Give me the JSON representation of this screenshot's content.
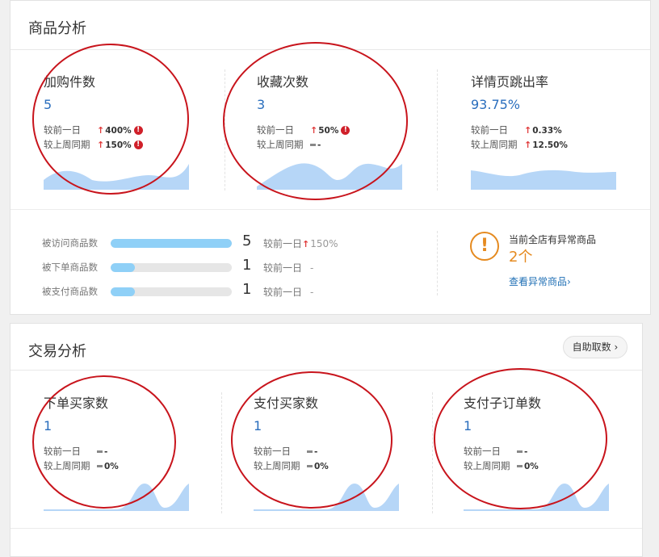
{
  "goods_analysis": {
    "title": "商品分析",
    "metrics": [
      {
        "title": "加购件数",
        "value": "5",
        "day_label": "较前一日",
        "day_value": "400%",
        "day_trend": "up",
        "day_alert": true,
        "week_label": "较上周同期",
        "week_value": "150%",
        "week_trend": "up",
        "week_alert": true
      },
      {
        "title": "收藏次数",
        "value": "3",
        "day_label": "较前一日",
        "day_value": "50%",
        "day_trend": "up",
        "day_alert": true,
        "week_label": "较上周同期",
        "week_value": "-",
        "week_trend": "flat",
        "week_alert": false
      },
      {
        "title": "详情页跳出率",
        "value": "93.75%",
        "day_label": "较前一日",
        "day_value": "0.33%",
        "day_trend": "up",
        "day_alert": false,
        "week_label": "较上周同期",
        "week_value": "12.50%",
        "week_trend": "up",
        "week_alert": false
      }
    ],
    "bars": [
      {
        "label": "被访问商品数",
        "count": "5",
        "cmp_label": "较前一日",
        "cmp_value": "150%",
        "trend": "up",
        "fill": 1.0
      },
      {
        "label": "被下单商品数",
        "count": "1",
        "cmp_label": "较前一日",
        "cmp_value": "-",
        "trend": "flat",
        "fill": 0.2
      },
      {
        "label": "被支付商品数",
        "count": "1",
        "cmp_label": "较前一日",
        "cmp_value": "-",
        "trend": "flat",
        "fill": 0.2
      }
    ],
    "warning": {
      "icon": "exclamation-circle-icon",
      "text": "当前全店有异常商品",
      "count": "2个",
      "link": "查看异常商品"
    }
  },
  "trade_analysis": {
    "title": "交易分析",
    "button": "自助取数",
    "metrics": [
      {
        "title": "下单买家数",
        "value": "1",
        "day_label": "较前一日",
        "day_value": "-",
        "day_trend": "flat",
        "week_label": "较上周同期",
        "week_value": "0%",
        "week_trend": "flat"
      },
      {
        "title": "支付买家数",
        "value": "1",
        "day_label": "较前一日",
        "day_value": "-",
        "day_trend": "flat",
        "week_label": "较上周同期",
        "week_value": "0%",
        "week_trend": "flat"
      },
      {
        "title": "支付子订单数",
        "value": "1",
        "day_label": "较前一日",
        "day_value": "-",
        "day_trend": "flat",
        "week_label": "较上周同期",
        "week_value": "0%",
        "week_trend": "flat"
      }
    ]
  },
  "colors": {
    "accent": "#2a6ebd",
    "up": "#e03a3a",
    "warning": "#e58a1f",
    "spark": "#b6d6f7",
    "annotation": "#c8141c",
    "link": "#1f6fb5"
  }
}
